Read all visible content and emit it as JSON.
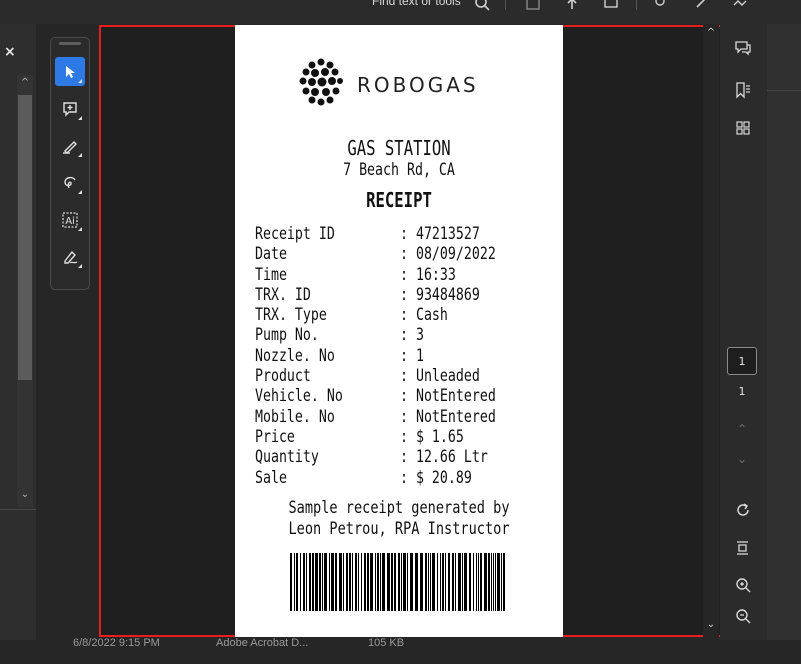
{
  "top_toolbar": {
    "find_text": "Find text or tools",
    "icons": [
      "search-icon",
      "save-icon",
      "upload-icon",
      "print-icon",
      "search-zoom-icon",
      "link-icon",
      "image-icon"
    ]
  },
  "left_panel": {
    "close_label": "×",
    "scroll_up": "^",
    "scroll_down": "⌄"
  },
  "tools": [
    "select-tool-icon",
    "add-comment-icon",
    "highlight-pen-icon",
    "lasso-draw-icon",
    "text-recognition-icon",
    "signature-icon"
  ],
  "receipt": {
    "brand": "ROBOGAS",
    "title": "GAS STATION",
    "address": "7 Beach Rd, CA",
    "heading": "RECEIPT",
    "rows": [
      {
        "label": "Receipt ID",
        "value": ": 47213527"
      },
      {
        "label": "Date",
        "value": ": 08/09/2022"
      },
      {
        "label": "Time",
        "value": ": 16:33"
      },
      {
        "label": "TRX. ID",
        "value": ": 93484869"
      },
      {
        "label": "TRX. Type",
        "value": ": Cash"
      },
      {
        "label": "Pump No.",
        "value": ": 3"
      },
      {
        "label": "Nozzle. No",
        "value": ": 1"
      },
      {
        "label": "Product",
        "value": ": Unleaded"
      },
      {
        "label": "Vehicle. No",
        "value": ": NotEntered"
      },
      {
        "label": "Mobile. No",
        "value": ": NotEntered"
      },
      {
        "label": "Price",
        "value": ": $ 1.65"
      },
      {
        "label": "Quantity",
        "value": ": 12.66 Ltr"
      },
      {
        "label": "Sale",
        "value": ": $ 20.89"
      }
    ],
    "note_line1": "Sample receipt generated by",
    "note_line2": "Leon Petrou, RPA Instructor"
  },
  "doc_scroll": {
    "up": "^",
    "down": "⌄"
  },
  "right_panel": {
    "icons": [
      "comment-icon",
      "bookmark-icon",
      "thumbnails-icon",
      "rotate-icon",
      "fit-page-icon",
      "zoom-in-icon",
      "zoom-out-icon"
    ],
    "current_page": "1",
    "total_pages": "1",
    "page_up": "⌃",
    "page_down": "⌄"
  },
  "status_bar": {
    "date": "6/8/2022 9:15 PM",
    "app": "Adobe Acrobat D...",
    "size": "105 KB"
  },
  "colors": {
    "selection_border": "#e81e1e",
    "active_tool": "#2d7ae6",
    "background": "#262626"
  }
}
